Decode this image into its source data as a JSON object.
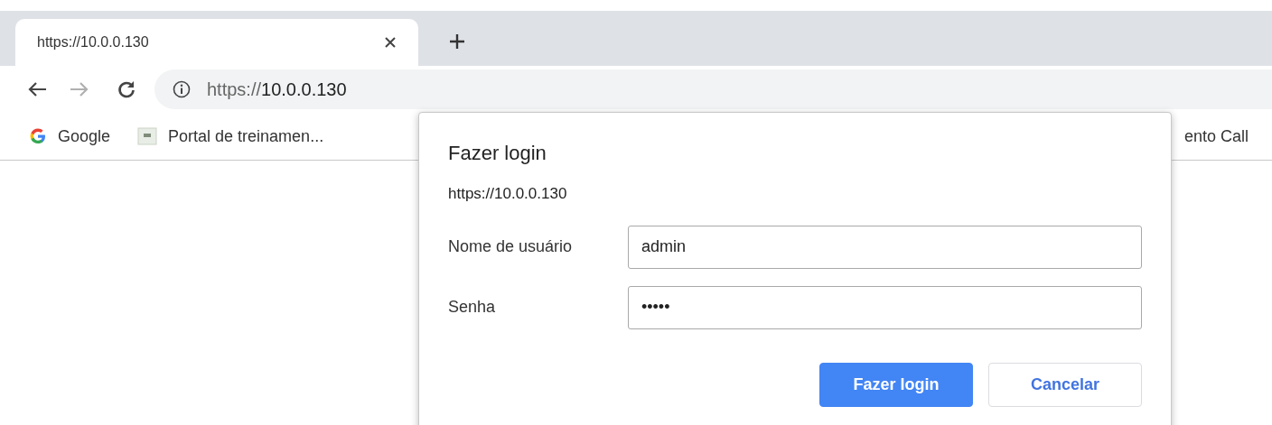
{
  "tab": {
    "title": "https://10.0.0.130",
    "selected": true
  },
  "toolbar": {
    "url_scheme": "https://",
    "url_host": "10.0.0.130"
  },
  "bookmarks": [
    {
      "label": "Google",
      "kind": "google"
    },
    {
      "label": "Portal de treinamen...",
      "kind": "site"
    },
    {
      "label": "ento Call",
      "kind": "plain"
    }
  ],
  "dialog": {
    "title": "Fazer login",
    "origin": "https://10.0.0.130",
    "fields": [
      {
        "label": "Nome de usuário",
        "value": "admin"
      },
      {
        "label": "Senha",
        "value": "•••••"
      }
    ],
    "buttons": [
      {
        "label": "Fazer login",
        "kind": "primary"
      },
      {
        "label": "Cancelar",
        "kind": "secondary"
      }
    ]
  }
}
